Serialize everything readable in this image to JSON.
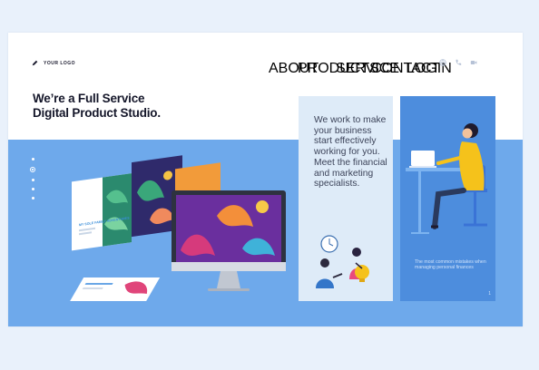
{
  "brand": {
    "logo_text": "YOUR LOGO",
    "logo_icon": "pencil-icon"
  },
  "nav": {
    "items": [
      {
        "label": "ABOUT",
        "active": true
      },
      {
        "label": "PRODUCTS",
        "active": false
      },
      {
        "label": "SERVICE",
        "active": false
      },
      {
        "label": "CONTACT",
        "active": false
      },
      {
        "label": "LOGIN",
        "active": false
      }
    ],
    "icons": [
      "globe-icon",
      "phone-icon",
      "video-icon"
    ]
  },
  "hero": {
    "headline_line1": "We’re a Full Service",
    "headline_line2": "Digital Product Studio."
  },
  "slider": {
    "count": 5,
    "active_index": 1
  },
  "mockup": {
    "screen_title": "MY SOLE FAMILY ADVENTURES"
  },
  "card_text": {
    "body": "We work to make your business start effectively working for you. Meet the financial and marketing specialists."
  },
  "card_blue": {
    "caption": "The most common mistakes when managing personal finances",
    "page_number": "1"
  },
  "colors": {
    "band": "#6ea9eb",
    "card_light": "#deebf8",
    "card_blue": "#4d8ddd",
    "accent_yellow": "#f5c21b",
    "headline": "#141629"
  }
}
